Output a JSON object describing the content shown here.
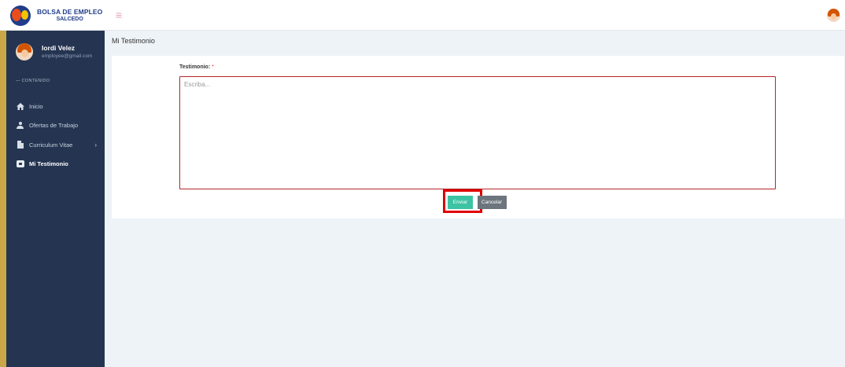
{
  "brand": {
    "line1": "BOLSA DE EMPLEO",
    "line2": "SALCEDO",
    "logo_icon": "brand-logo-icon"
  },
  "header": {
    "menu_icon": "hamburger-icon",
    "avatar_icon": "user-avatar-icon"
  },
  "user": {
    "name": "Iordi Velez",
    "email": "employee@gmail.com"
  },
  "sidebar": {
    "section_label": "— CONTENIDO",
    "items": [
      {
        "label": "Inicio",
        "icon": "home-icon",
        "active": false
      },
      {
        "label": "Ofertas de Trabajo",
        "icon": "person-icon",
        "active": false
      },
      {
        "label": "Curriculum Vitae",
        "icon": "document-icon",
        "active": false,
        "has_submenu": true
      },
      {
        "label": "Mi Testimonio",
        "icon": "chat-icon",
        "active": true
      }
    ]
  },
  "page": {
    "title": "Mi Testimonio"
  },
  "form": {
    "label": "Testimonio:",
    "required_mark": "*",
    "placeholder": "Escriba...",
    "value": "",
    "submit_label": "Enviar",
    "cancel_label": "Cancelar"
  },
  "colors": {
    "sidebar_bg": "#253551",
    "accent_stripe": "#c9a747",
    "submit_bg": "#3cc3a3",
    "cancel_bg": "#6c757d",
    "textarea_border": "#b3262e",
    "highlight_box": "#e00000"
  }
}
